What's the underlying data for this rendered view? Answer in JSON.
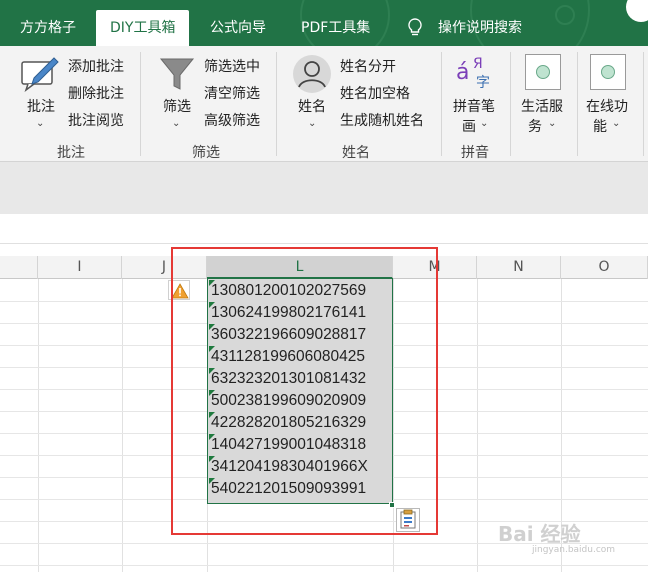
{
  "ribbon_tabs": [
    "方方格子",
    "DIY工具箱",
    "公式向导",
    "PDF工具集",
    "操作说明搜索"
  ],
  "active_tab": "DIY工具箱",
  "ribbon": {
    "comment": {
      "big_label": "批注",
      "items": [
        "添加批注",
        "删除批注",
        "批注阅览"
      ],
      "group": "批注"
    },
    "filter": {
      "big_label": "筛选",
      "items": [
        "筛选选中",
        "清空筛选",
        "高级筛选"
      ],
      "group": "筛选"
    },
    "name": {
      "big_label": "姓名",
      "items": [
        "姓名分开",
        "姓名加空格",
        "生成随机姓名"
      ],
      "group": "姓名"
    },
    "pinyin": {
      "big_label": "拼音笔画",
      "big_label_1": "拼音笔",
      "big_label_2": "画",
      "group": "拼音",
      "icon_text": "ά Я 字"
    },
    "life": {
      "label_1": "生活服",
      "label_2": "务"
    },
    "online": {
      "label_1": "在线功",
      "label_2": "能"
    }
  },
  "columns": [
    "I",
    "J",
    "L",
    "M",
    "N",
    "O"
  ],
  "selected_column": "L",
  "cells": [
    "130801200102027569",
    "130624199802176141",
    "360322196609028817",
    "431128199606080425",
    "632323201301081432",
    "500238199609020909",
    "422828201805216329",
    "140427199001048318",
    "3412041983040196​6X",
    "540221201509093991"
  ],
  "watermark": {
    "line1": "Bai 经验",
    "line2": "jingyan.baidu.com"
  },
  "colors": {
    "excel_green": "#217346",
    "highlight_red": "#e53935",
    "selection_gray": "#d9d9d9",
    "warning_orange": "#f0a030"
  },
  "icons": [
    "lightbulb-icon",
    "comment-pen-icon",
    "funnel-icon",
    "person-icon",
    "pinyin-icon",
    "life-service-icon",
    "online-feature-icon",
    "warning-icon",
    "paste-options-icon"
  ]
}
